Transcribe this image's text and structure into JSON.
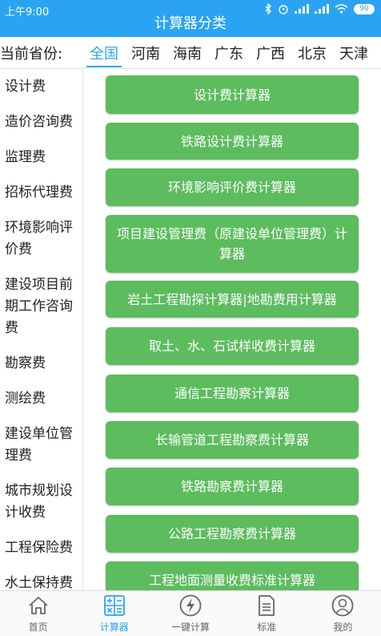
{
  "status_bar": {
    "time": "上午9:00",
    "battery": "90"
  },
  "header": {
    "title": "计算器分类"
  },
  "province": {
    "label": "当前省份:",
    "tabs": [
      "全国",
      "河南",
      "海南",
      "广东",
      "广西",
      "北京",
      "天津"
    ],
    "selected": "全国"
  },
  "categories": [
    "设计费",
    "造价咨询费",
    "监理费",
    "招标代理费",
    "环境影响评价费",
    "建设项目前期工作咨询费",
    "勘察费",
    "测绘费",
    "建设单位管理费",
    "城市规划设计收费",
    "工程保险费",
    "水土保持费"
  ],
  "calculators": [
    "设计费计算器",
    "铁路设计费计算器",
    "环境影响评价费计算器",
    "项目建设管理费（原建设单位管理费）计算器",
    "岩土工程勘探计算器|地勘费用计算器",
    "取土、水、石试样收费计算器",
    "通信工程勘察计算器",
    "长输管道工程勘察费计算器",
    "铁路勘察费计算器",
    "公路工程勘察费计算器",
    "工程地面测量收费标准计算器"
  ],
  "bottom_nav": [
    {
      "label": "首页",
      "icon": "home-icon"
    },
    {
      "label": "计算器",
      "icon": "calculator-icon"
    },
    {
      "label": "一键计算",
      "icon": "lightning-icon"
    },
    {
      "label": "标准",
      "icon": "document-icon"
    },
    {
      "label": "我的",
      "icon": "user-icon"
    }
  ],
  "colors": {
    "primary": "#2AA4F2",
    "button_green": "#5CBC5E"
  }
}
